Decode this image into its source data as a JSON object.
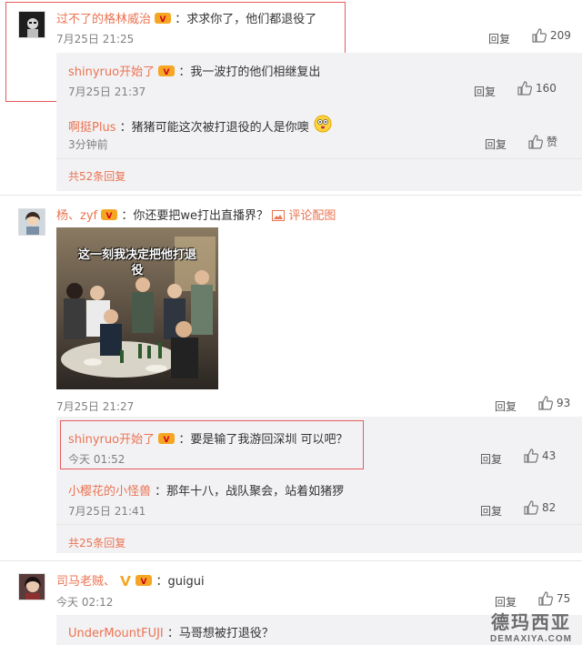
{
  "comments": [
    {
      "user": "过不了的格林威治",
      "text": "：求求你了，他们都退役了",
      "time": "7月25日 21:25",
      "reply": "回复",
      "likes": "209",
      "replies": [
        {
          "user": "shinyruo开始了",
          "text": "：我一波打的他们相继复出",
          "time": "7月25日 21:37",
          "reply": "回复",
          "likes": "160"
        },
        {
          "user": "啊挺Plus",
          "text": "：猪猪可能这次被打退役的人是你噢",
          "time": "3分钟前",
          "reply": "回复",
          "likes": "赞"
        }
      ],
      "more": "共52条回复"
    },
    {
      "user": "杨、zyf",
      "text": "：你还要把we打出直播界？",
      "pic_link": "评论配图",
      "image_caption": "这一刻我决定把他打退役",
      "time": "7月25日 21:27",
      "reply": "回复",
      "likes": "93",
      "replies": [
        {
          "user": "shinyruo开始了",
          "text": "：要是输了我游回深圳 可以吧？",
          "time": "今天 01:52",
          "reply": "回复",
          "likes": "43"
        },
        {
          "user": "小樱花的小怪兽",
          "text": "：那年十八，战队聚会，站着如猪猡",
          "time": "7月25日 21:41",
          "reply": "回复",
          "likes": "82"
        }
      ],
      "more": "共25条回复"
    },
    {
      "user": "司马老贼、",
      "text": "：guigui",
      "time": "今天 02:12",
      "reply": "回复",
      "likes": "75",
      "replies": [
        {
          "user": "UnderMountFUJI",
          "text": "：马哥想被打退役？"
        }
      ]
    }
  ],
  "watermark": {
    "main": "德玛西亚",
    "sub": "DEMAXIYA.COM"
  },
  "colors": {
    "username": "#eb7350",
    "highlight_box": "#e55b5b",
    "sub_bg": "#f2f2f5"
  }
}
